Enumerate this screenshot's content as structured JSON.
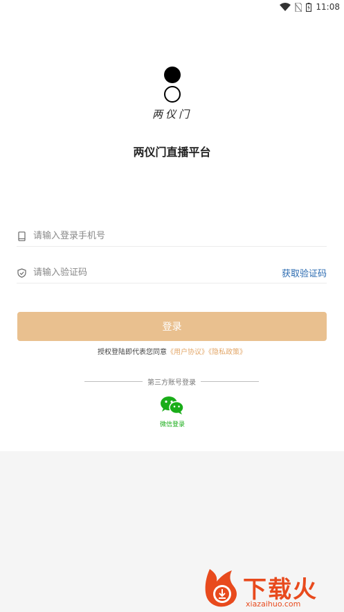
{
  "status_bar": {
    "time": "11:08"
  },
  "logo": {
    "text": "两仪门"
  },
  "app_title": "两仪门直播平台",
  "phone_field": {
    "placeholder": "请输入登录手机号",
    "value": ""
  },
  "code_field": {
    "placeholder": "请输入验证码",
    "value": "",
    "get_code_label": "获取验证码"
  },
  "login_button": {
    "label": "登录"
  },
  "agreement": {
    "prefix": "授权登陆即代表您同意",
    "user_agreement": "《用户协议》",
    "privacy_policy": "《隐私政策》"
  },
  "third_party": {
    "divider_label": "第三方账号登录",
    "wechat_label": "微信登录"
  },
  "watermark": {
    "brand": "下载火",
    "site": "xiazaihuo.com"
  },
  "colors": {
    "login_button": "#e9c08f",
    "link_blue": "#2a6ab0",
    "link_orange": "#e3a86b",
    "wechat_green": "#1aad19",
    "watermark": "#e84a1d"
  }
}
